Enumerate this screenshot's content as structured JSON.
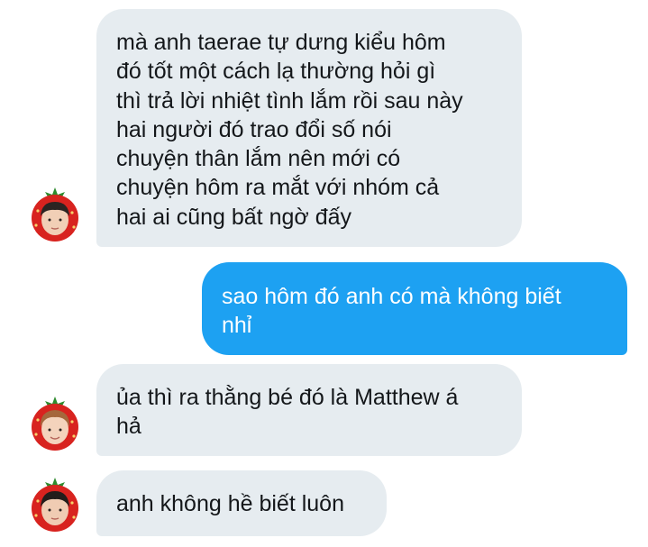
{
  "colors": {
    "incoming_bubble": "#e6ecf0",
    "outgoing_bubble": "#1da1f2",
    "incoming_text": "#14171a",
    "outgoing_text": "#ffffff",
    "avatar_frame": "#d8231f",
    "avatar_leaf": "#2e8b2e"
  },
  "messages": [
    {
      "sender": "other",
      "text": "mà anh taerae tự dưng kiểu hôm\nđó tốt một cách lạ thường hỏi gì\nthì trả lời nhiệt tình lắm rồi sau này\nhai người đó trao đổi số nói\nchuyện thân lắm nên mới có\nchuyện hôm ra mắt với nhóm cả\nhai ai cũng bất ngờ đấy",
      "avatar_icon": "strawberry-frame-avatar-icon"
    },
    {
      "sender": "me",
      "text": "sao hôm đó anh có mà không biết\nnhỉ"
    },
    {
      "sender": "other",
      "text": "ủa thì ra thằng bé đó là Matthew á\nhả",
      "avatar_icon": "strawberry-frame-avatar-icon"
    },
    {
      "sender": "other",
      "text": "anh không hề biết luôn",
      "avatar_icon": "strawberry-frame-avatar-icon"
    }
  ]
}
